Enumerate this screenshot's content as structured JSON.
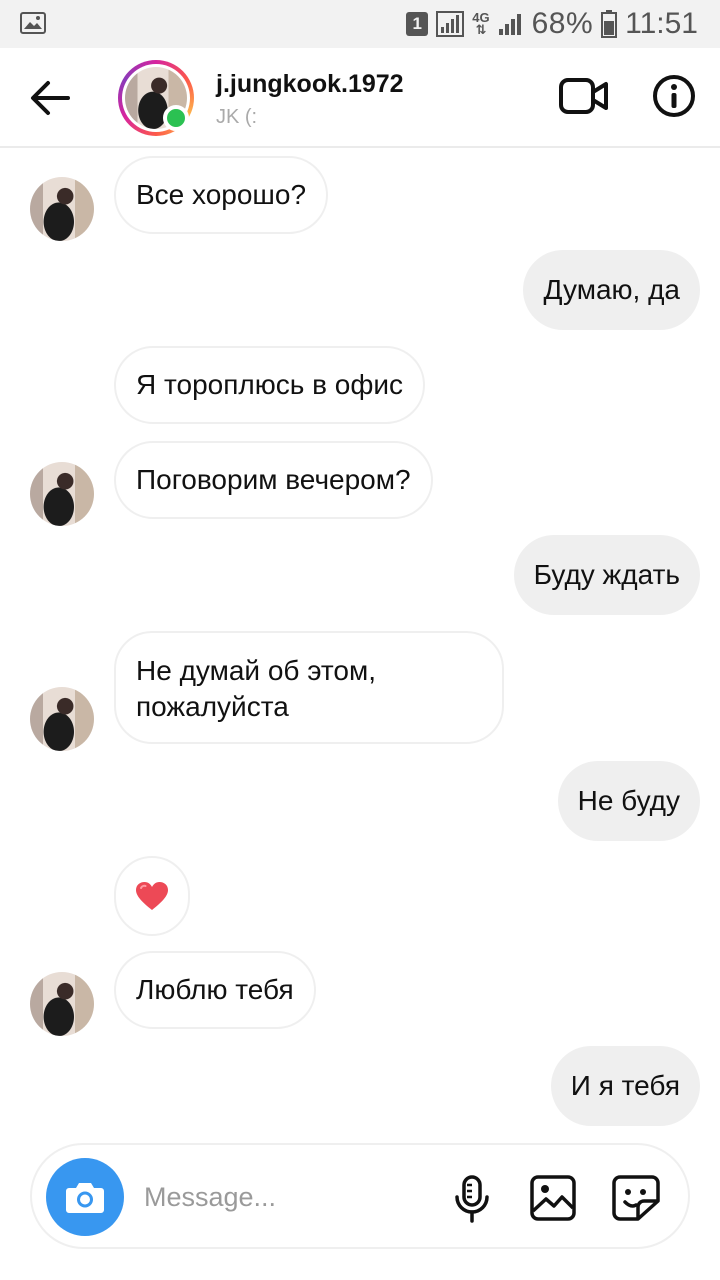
{
  "status_bar": {
    "sim_slot": "1",
    "network": "4G",
    "battery": "68%",
    "time": "11:51"
  },
  "header": {
    "username": "j.jungkook.1972",
    "subtitle": "JK (:",
    "online": true
  },
  "messages": [
    {
      "side": "in",
      "text": "Все хорошо?",
      "show_avatar": true
    },
    {
      "side": "out",
      "text": "Думаю, да"
    },
    {
      "side": "in",
      "text": "Я тороплюсь в офис",
      "show_avatar": false
    },
    {
      "side": "in",
      "text": "Поговорим вечером?",
      "show_avatar": true
    },
    {
      "side": "out",
      "text": "Буду ждать"
    },
    {
      "side": "in",
      "text": "Не думай об этом, пожалуйста",
      "show_avatar": true
    },
    {
      "side": "out",
      "text": "Не буду"
    },
    {
      "side": "in",
      "type": "heart",
      "show_avatar": false
    },
    {
      "side": "in",
      "text": "Люблю тебя",
      "show_avatar": true
    },
    {
      "side": "out",
      "text": "И я тебя"
    }
  ],
  "composer": {
    "placeholder": "Message...",
    "value": ""
  },
  "colors": {
    "accent": "#3897f0",
    "online": "#2bc152",
    "heart": "#ed4956",
    "bubble_out": "#efefef"
  },
  "icons": [
    "back-arrow-icon",
    "video-call-icon",
    "info-icon",
    "camera-icon",
    "microphone-icon",
    "gallery-icon",
    "sticker-icon",
    "heart-icon"
  ]
}
